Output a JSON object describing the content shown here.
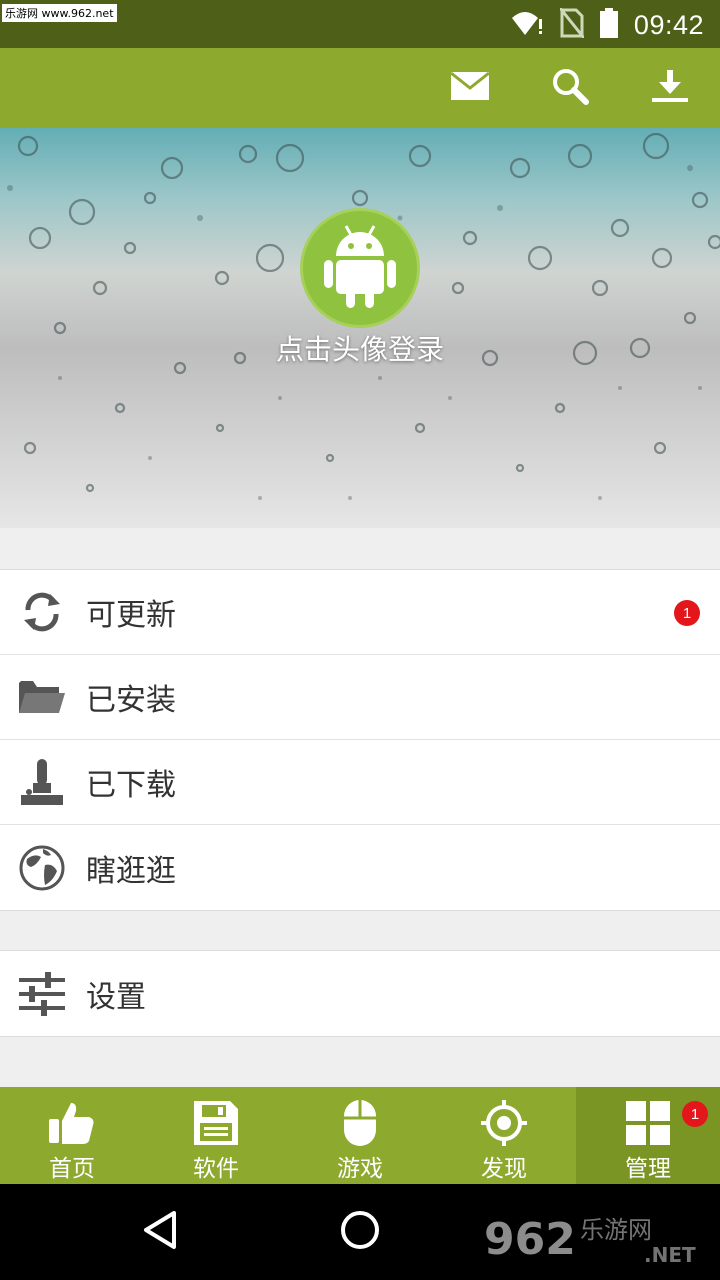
{
  "status_bar": {
    "watermark": "乐游网 www.962.net",
    "time": "09:42",
    "icons": [
      "wifi-icon",
      "no-sim-icon",
      "battery-icon"
    ]
  },
  "toolbar": {
    "icons": [
      "mail-icon",
      "search-icon",
      "download-icon"
    ]
  },
  "profile": {
    "login_text": "点击头像登录",
    "avatar_icon": "android-icon"
  },
  "menu": {
    "items": [
      {
        "label": "可更新",
        "icon": "refresh-icon",
        "badge": "1"
      },
      {
        "label": "已安装",
        "icon": "folder-icon"
      },
      {
        "label": "已下载",
        "icon": "joystick-icon"
      },
      {
        "label": "瞎逛逛",
        "icon": "globe-icon"
      }
    ],
    "settings": {
      "label": "设置",
      "icon": "sliders-icon"
    }
  },
  "bottom_nav": {
    "items": [
      {
        "label": "首页",
        "icon": "thumbs-up-icon"
      },
      {
        "label": "软件",
        "icon": "floppy-icon"
      },
      {
        "label": "游戏",
        "icon": "mouse-icon"
      },
      {
        "label": "发现",
        "icon": "target-icon"
      },
      {
        "label": "管理",
        "icon": "grid-icon",
        "badge": "1",
        "active": true
      }
    ]
  },
  "watermark_bottom": {
    "text1": "962",
    "text2": "乐游网",
    "text3": ".NET"
  },
  "colors": {
    "status_bar": "#4e5f18",
    "toolbar": "#8da92e",
    "nav_active": "#7b9524",
    "badge": "#e3161c",
    "avatar": "#8fc23f"
  }
}
